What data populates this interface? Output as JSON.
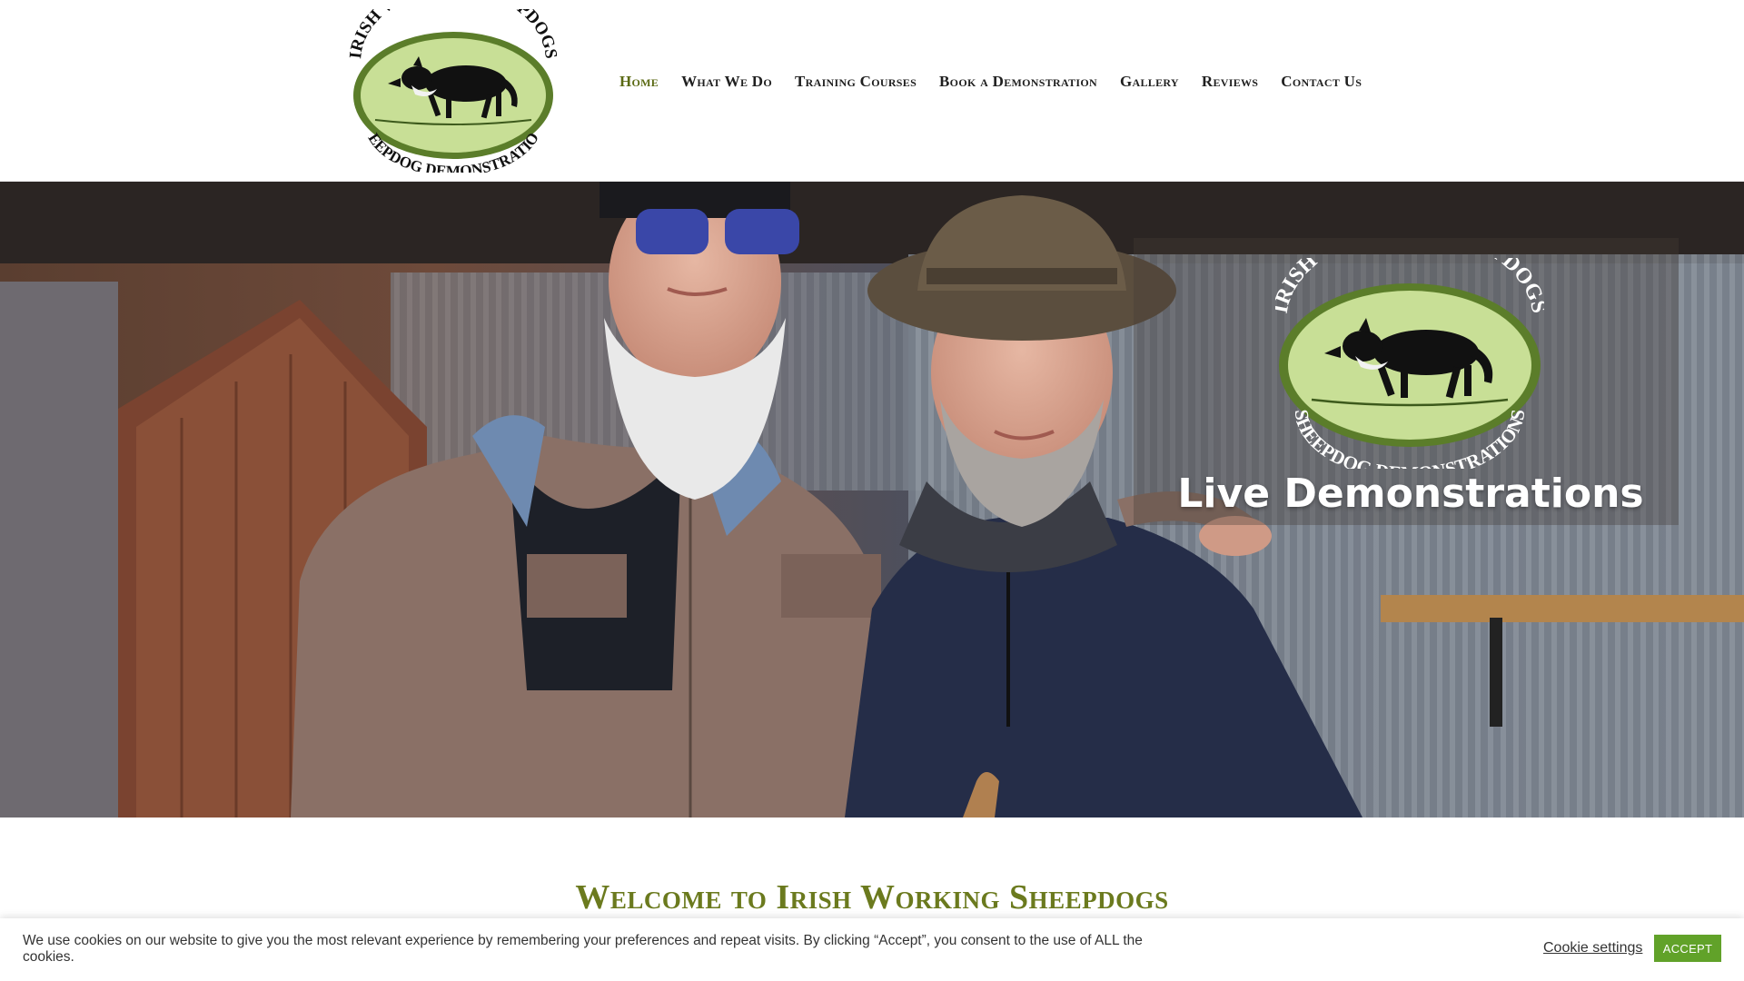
{
  "header": {
    "logo": {
      "top_text": "IRISH WORKING SHEEPDOGS",
      "bottom_text": "SHEEPDOG DEMONSTRATIONS",
      "icon": "sheepdog-logo"
    },
    "nav": [
      {
        "label": "Home",
        "active": true
      },
      {
        "label": "What We Do",
        "active": false
      },
      {
        "label": "Training Courses",
        "active": false
      },
      {
        "label": "Book a Demonstration",
        "active": false
      },
      {
        "label": "Gallery",
        "active": false
      },
      {
        "label": "Reviews",
        "active": false
      },
      {
        "label": "Contact Us",
        "active": false
      }
    ]
  },
  "hero": {
    "title": "Live Demonstrations",
    "logo": {
      "top_text": "IRISH WORKING SHEEPDOGS",
      "bottom_text": "SHEEPDOG DEMONSTRATIONS"
    }
  },
  "welcome": {
    "heading": "Welcome to Irish Working Sheepdogs"
  },
  "cookie": {
    "text": "We use cookies on our website to give you the most relevant experience by remembering your preferences and repeat visits. By clicking “Accept”, you consent to the use of ALL the cookies.",
    "settings_label": "Cookie settings",
    "accept_label": "ACCEPT"
  },
  "colors": {
    "accent": "#5b6a14",
    "logo_green": "#5b7d2a",
    "logo_fill": "#c8df96",
    "accept_button": "#61a229"
  }
}
